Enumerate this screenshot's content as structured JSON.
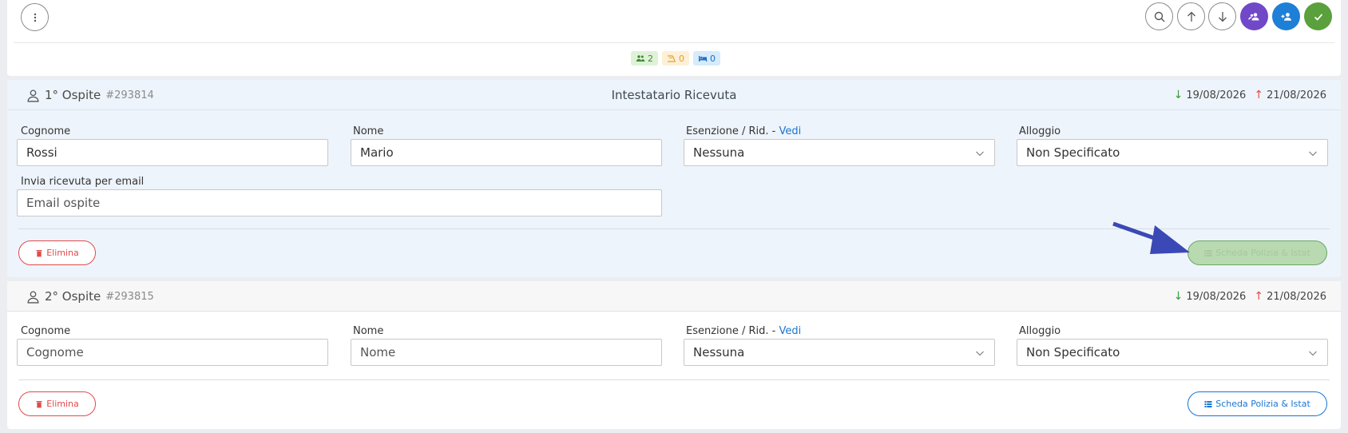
{
  "toolbar": {
    "menu_icon": "more-vertical-icon",
    "buttons": [
      {
        "icon": "search-icon"
      },
      {
        "icon": "arrow-up-icon"
      },
      {
        "icon": "arrow-down-icon"
      },
      {
        "icon": "group-add-icon",
        "color": "#7048c8"
      },
      {
        "icon": "person-add-icon",
        "color": "#1e7fd6"
      },
      {
        "icon": "check-icon",
        "color": "#5aa03c"
      }
    ]
  },
  "counters": {
    "guests": "2",
    "departures": "0",
    "beds": "0"
  },
  "guests": [
    {
      "title": "1° Ospite",
      "id": "#293814",
      "center_label": "Intestatario Ricevuta",
      "arrival": "19/08/2026",
      "departure": "21/08/2026",
      "labels": {
        "surname": "Cognome",
        "name": "Nome",
        "exemption": "Esenzione / Rid. -",
        "exemption_link": "Vedi",
        "lodging": "Alloggio",
        "email": "Invia ricevuta per email"
      },
      "surname": "Rossi",
      "name": "Mario",
      "exemption": "Nessuna",
      "lodging": "Non Specificato",
      "email_placeholder": "Email ospite",
      "delete_label": "Elimina",
      "form_label": "Scheda Polizia & Istat"
    },
    {
      "title": "2° Ospite",
      "id": "#293815",
      "arrival": "19/08/2026",
      "departure": "21/08/2026",
      "labels": {
        "surname": "Cognome",
        "name": "Nome",
        "exemption": "Esenzione / Rid. -",
        "exemption_link": "Vedi",
        "lodging": "Alloggio"
      },
      "surname_placeholder": "Cognome",
      "name_placeholder": "Nome",
      "exemption": "Nessuna",
      "lodging": "Non Specificato",
      "delete_label": "Elimina",
      "form_label": "Scheda Polizia & Istat"
    }
  ]
}
